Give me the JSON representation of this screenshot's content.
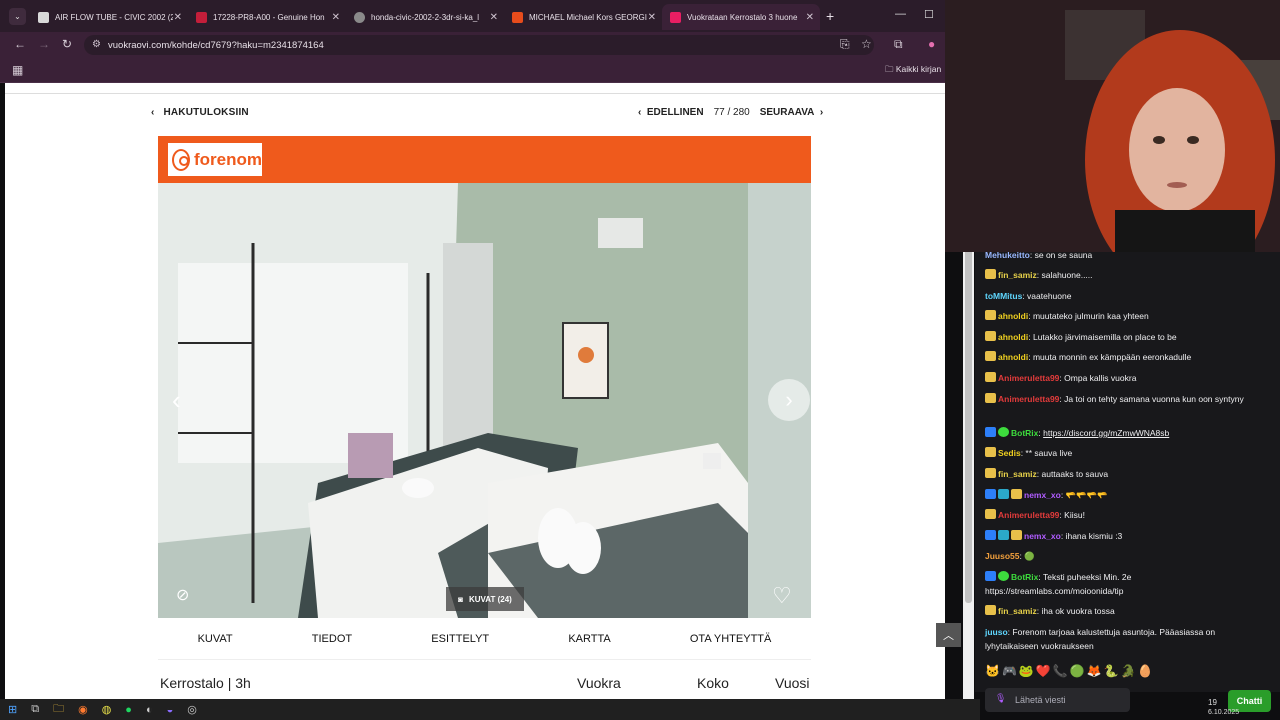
{
  "browser": {
    "tabs": [
      {
        "title": "AIR FLOW TUBE - CIVIC 2002 (2",
        "color": "#d9d9d9"
      },
      {
        "title": "17228-PR8-A00 - Genuine Hon",
        "color": "#c41e3a"
      },
      {
        "title": "honda-civic-2002-2-3dr-si-ka_l",
        "color": "#8a8a8a"
      },
      {
        "title": "MICHAEL Michael Kors GEORGI",
        "color": "#e74c1c"
      },
      {
        "title": "Vuokrataan Kerrostalo 3 huone",
        "color": "#e91e63"
      }
    ],
    "url": "vuokraovi.com/kohde/cd7679?haku=m2341874164",
    "bookmarks_label": "Kaikki kirjan"
  },
  "page": {
    "back_label": "HAKUTULOKSIIN",
    "prev_label": "EDELLINEN",
    "counter": "77 / 280",
    "next_label": "SEURAAVA",
    "logo_text": "forenom",
    "photo_button": "KUVAT (24)",
    "subnav": [
      "KUVAT",
      "TIEDOT",
      "ESITTELYT",
      "KARTTA",
      "OTA YHTEYTTÄ"
    ],
    "summary": {
      "type": "Kerrostalo | 3h",
      "rent_label": "Vuokra",
      "size_label": "Koko",
      "year_label": "Vuosi"
    }
  },
  "chat": {
    "messages": [
      {
        "user": "Mehukeitto",
        "color": "#9ab8ff",
        "text": "se on se sauna"
      },
      {
        "user": "fin_samiz",
        "color": "#e8d24a",
        "text": "salahuone....."
      },
      {
        "user": "toMMitus",
        "color": "#5fd7ff",
        "text": "vaatehuone"
      },
      {
        "user": "ahnoldi",
        "color": "#f0d020",
        "text": "muutateko julmurin kaa yhteen"
      },
      {
        "user": "ahnoldi",
        "color": "#f0d020",
        "text": "Lutakko järvimaisemilla on place to be"
      },
      {
        "user": "ahnoldi",
        "color": "#f0d020",
        "text": "muuta monnin ex kämppään eeronkadulle"
      },
      {
        "user": "Animeruletta99",
        "color": "#e23b3b",
        "text": "Ompa kallis vuokra"
      },
      {
        "user": "Animeruletta99",
        "color": "#e23b3b",
        "text": "Ja toi on tehty samana vuonna kun oon syntyny"
      },
      {
        "user": "BotRix",
        "color": "#3ddc3d",
        "text": "https://discord.gg/mZmwWNA8sb"
      },
      {
        "user": "Sedis",
        "color": "#f0d020",
        "text": "** sauva live"
      },
      {
        "user": "fin_samiz",
        "color": "#e8d24a",
        "text": "auttaaks to sauva"
      },
      {
        "user": "nemx_xo",
        "color": "#b05cff",
        "text": "🫳🫳🫳🫳"
      },
      {
        "user": "Animeruletta99",
        "color": "#e23b3b",
        "text": "Kiisu!"
      },
      {
        "user": "nemx_xo",
        "color": "#b05cff",
        "text": "ihana kismiu :3"
      },
      {
        "user": "Juuso55",
        "color": "#f2a03d",
        "text": "🟢"
      },
      {
        "user": "BotRix",
        "color": "#3ddc3d",
        "text": "Teksti puheeksi Min. 2e https://streamlabs.com/moioonida/tip"
      },
      {
        "user": "fin_samiz",
        "color": "#e8d24a",
        "text": "iha ok vuokra tossa"
      },
      {
        "user": "juuso",
        "color": "#5fd7ff",
        "text": "Forenom tarjoaa kalustettuja asuntoja. Pääasiassa on lyhytaikaiseen vuokraukseen"
      }
    ],
    "input_placeholder": "Lähetä viesti",
    "send_label": "Chatti"
  },
  "tray": {
    "time": "19",
    "date": "6.10.2025"
  }
}
